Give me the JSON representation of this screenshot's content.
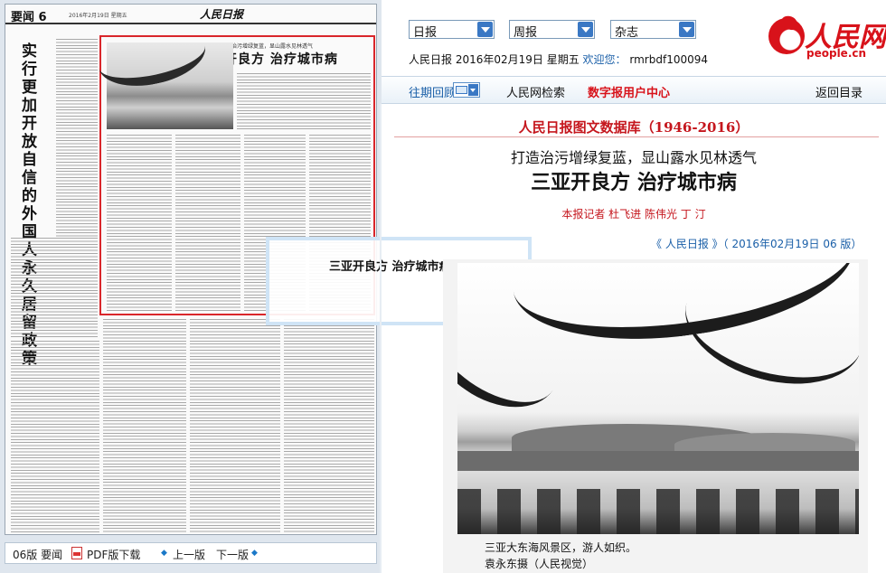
{
  "newspaper": {
    "section": "要闻  6",
    "date_line": "2016年2月19日 星期五",
    "masthead": "人民日报",
    "side_headline": "实行更加开放自信的外国人永久居留政策",
    "article_subtitle": "打造治污增绿复蓝，显山露水见林透气",
    "article_title": "三亚开良方  治疗城市病"
  },
  "tooltip": {
    "text": "三亚开良方  治疗城市病"
  },
  "page_nav": {
    "page_label": "06版 要闻",
    "pdf_label": "PDF版下载",
    "prev_label": "上一版",
    "next_label": "下一版"
  },
  "selectors": {
    "daily": "日报",
    "weekly": "周报",
    "magazine": "杂志"
  },
  "paper_info": {
    "text": "人民日报 2016年02月19日 星期五",
    "welcome": "欢迎您：",
    "user": "rmrbdf100094"
  },
  "brand": {
    "name_cn": "人民网",
    "name_en": "people.cn"
  },
  "toolbar": {
    "back_issues": "往期回顾",
    "search": "人民网检索",
    "digital_center": "数字报用户中心",
    "back_to_index": "返回目录"
  },
  "article": {
    "database_title": "人民日报图文数据库（1946-2016）",
    "subtitle": "打造治污增绿复蓝，显山露水见林透气",
    "title": "三亚开良方 治疗城市病",
    "byline": "本报记者 杜飞进 陈伟光 丁 汀",
    "source": "《 人民日报 》（ 2016年02月19日   06 版）",
    "caption_line1": "三亚大东海风景区，游人如织。",
    "caption_line2": "袁永东摄（人民视觉）"
  },
  "colors": {
    "brand_red": "#c5161d",
    "link_blue": "#1a5fa8",
    "select_blue": "#3a78c4",
    "frame_red": "#d9262b"
  }
}
